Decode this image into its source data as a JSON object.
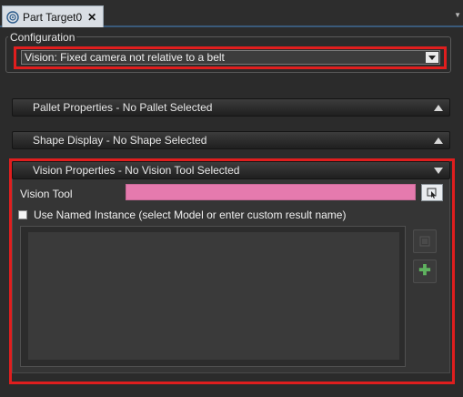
{
  "tab": {
    "title": "Part Target0",
    "close": "✕"
  },
  "config": {
    "legend": "Configuration",
    "selected": "Vision: Fixed camera not relative to a belt"
  },
  "sections": {
    "pallet": "Pallet Properties - No Pallet Selected",
    "shape": "Shape Display - No Shape Selected",
    "vision": "Vision Properties - No Vision Tool Selected"
  },
  "vision": {
    "tool_label": "Vision Tool",
    "tool_value": "",
    "named_instance_label": "Use Named Instance (select Model or enter custom result name)",
    "named_instance_checked": false
  },
  "colors": {
    "highlight": "#e01e1e",
    "tool_field": "#e57aae",
    "add_icon": "#5fb25f"
  }
}
